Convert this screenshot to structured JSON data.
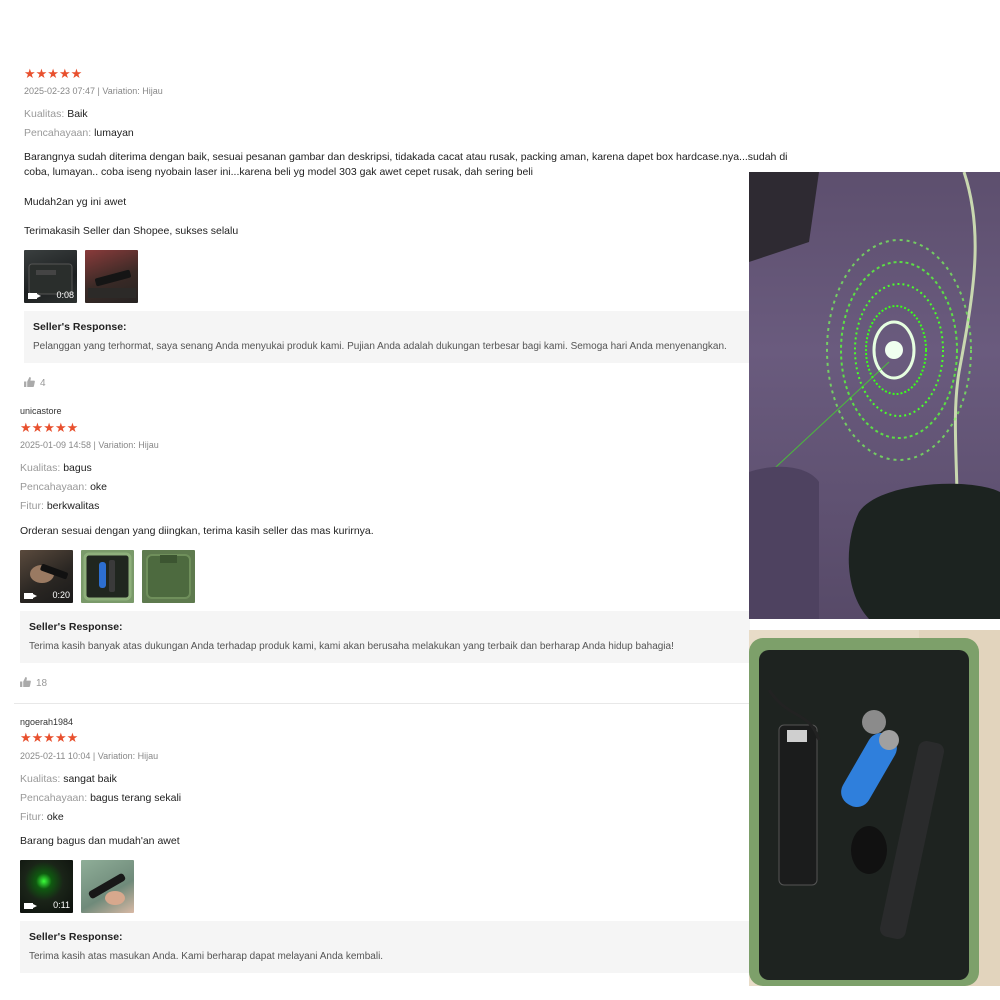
{
  "reviews": [
    {
      "username": "",
      "stars": "★★★★★",
      "meta": "2025-02-23 07:47 | Variation: Hijau",
      "attrs": [
        {
          "key": "Kualitas:",
          "value": "Baik"
        },
        {
          "key": "Pencahayaan:",
          "value": "lumayan"
        }
      ],
      "paragraphs": [
        "Barangnya sudah diterima dengan baik, sesuai pesanan gambar dan deskripsi, tidakada cacat atau rusak, packing aman, karena dapet box hardcase.nya...sudah di coba, lumayan.. coba iseng nyobain laser ini...karena beli yg model 303 gak awet cepet rusak, dah sering beli",
        "Mudah2an yg ini awet",
        "Terimakasih Seller dan Shopee, sukses selalu"
      ],
      "video_duration": "0:08",
      "response_title": "Seller's Response:",
      "response_text": "Pelanggan yang terhormat, saya senang Anda menyukai produk kami. Pujian Anda adalah dukungan terbesar bagi kami. Semoga hari Anda menyenangkan.",
      "likes": "4"
    },
    {
      "username": "unicastore",
      "stars": "★★★★★",
      "meta": "2025-01-09 14:58 | Variation: Hijau",
      "attrs": [
        {
          "key": "Kualitas:",
          "value": "bagus"
        },
        {
          "key": "Pencahayaan:",
          "value": "oke"
        },
        {
          "key": "Fitur:",
          "value": "berkwalitas"
        }
      ],
      "paragraphs": [
        "Orderan sesuai dengan yang diingkan, terima kasih seller das mas kurirnya."
      ],
      "video_duration": "0:20",
      "response_title": "Seller's Response:",
      "response_text": "Terima kasih banyak atas dukungan Anda terhadap produk kami, kami akan berusaha melakukan yang terbaik dan berharap Anda hidup bahagia!",
      "likes": "18"
    },
    {
      "username": "ngoerah1984",
      "stars": "★★★★★",
      "meta": "2025-02-11 10:04 | Variation: Hijau",
      "attrs": [
        {
          "key": "Kualitas:",
          "value": "sangat baik"
        },
        {
          "key": "Pencahayaan:",
          "value": "bagus terang sekali"
        },
        {
          "key": "Fitur:",
          "value": "oke"
        }
      ],
      "paragraphs": [
        "Barang bagus dan mudah'an awet"
      ],
      "video_duration": "0:11",
      "response_title": "Seller's Response:",
      "response_text": "Terima kasih atas masukan Anda. Kami berharap dapat melayani Anda kembali."
    }
  ],
  "colors": {
    "star": "#e8502e",
    "response_bg": "#f5f5f5",
    "laser_green": "#39ff14"
  },
  "icons": {
    "like": "thumbs-up-icon",
    "video": "video-camera-icon"
  }
}
